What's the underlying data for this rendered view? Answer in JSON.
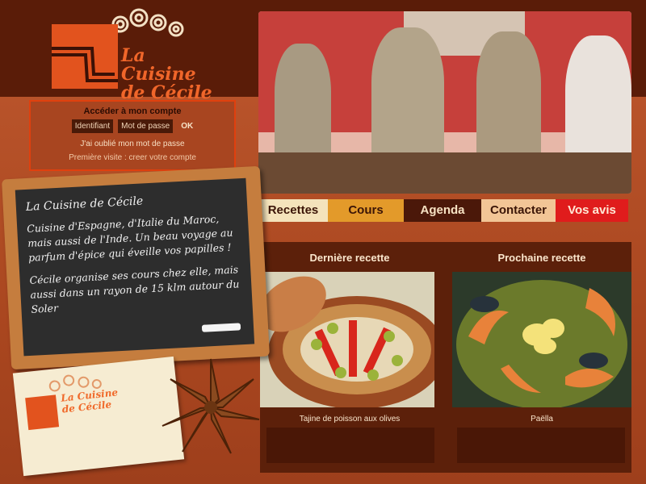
{
  "brand": {
    "line1": "La Cuisine",
    "line2": "de Cécile"
  },
  "login": {
    "title": "Accéder à mon compte",
    "username_placeholder": "Identifiant",
    "password_placeholder": "Mot de passe",
    "ok_label": "OK",
    "forgot_link": "J'ai oublié mon mot de passe",
    "first_visit_link": "Première visite : creer votre compte"
  },
  "nav": {
    "items": [
      {
        "label": "Recettes"
      },
      {
        "label": "Cours"
      },
      {
        "label": "Agenda"
      },
      {
        "label": "Contacter"
      },
      {
        "label": "Vos avis"
      }
    ]
  },
  "recipes": {
    "last_title": "Dernière recette",
    "next_title": "Prochaine recette",
    "last_caption": "Tajine de poisson aux olives",
    "next_caption": "Paëlla"
  },
  "board": {
    "title": "La Cuisine de Cécile",
    "paragraph1": "Cuisine d'Espagne, d'Italie du Maroc, mais aussi de l'Inde. Un beau voyage au parfum d'épice qui éveille vos papilles !",
    "paragraph2": "Cécile organise ses cours chez elle, mais aussi dans un rayon de 15 klm autour du Soler"
  },
  "card": {
    "line1": "La Cuisine",
    "line2": "de Cécile"
  },
  "colors": {
    "brand_orange": "#e2531e",
    "dark_brown": "#5a1c08",
    "accent_red": "#e01c1c"
  }
}
